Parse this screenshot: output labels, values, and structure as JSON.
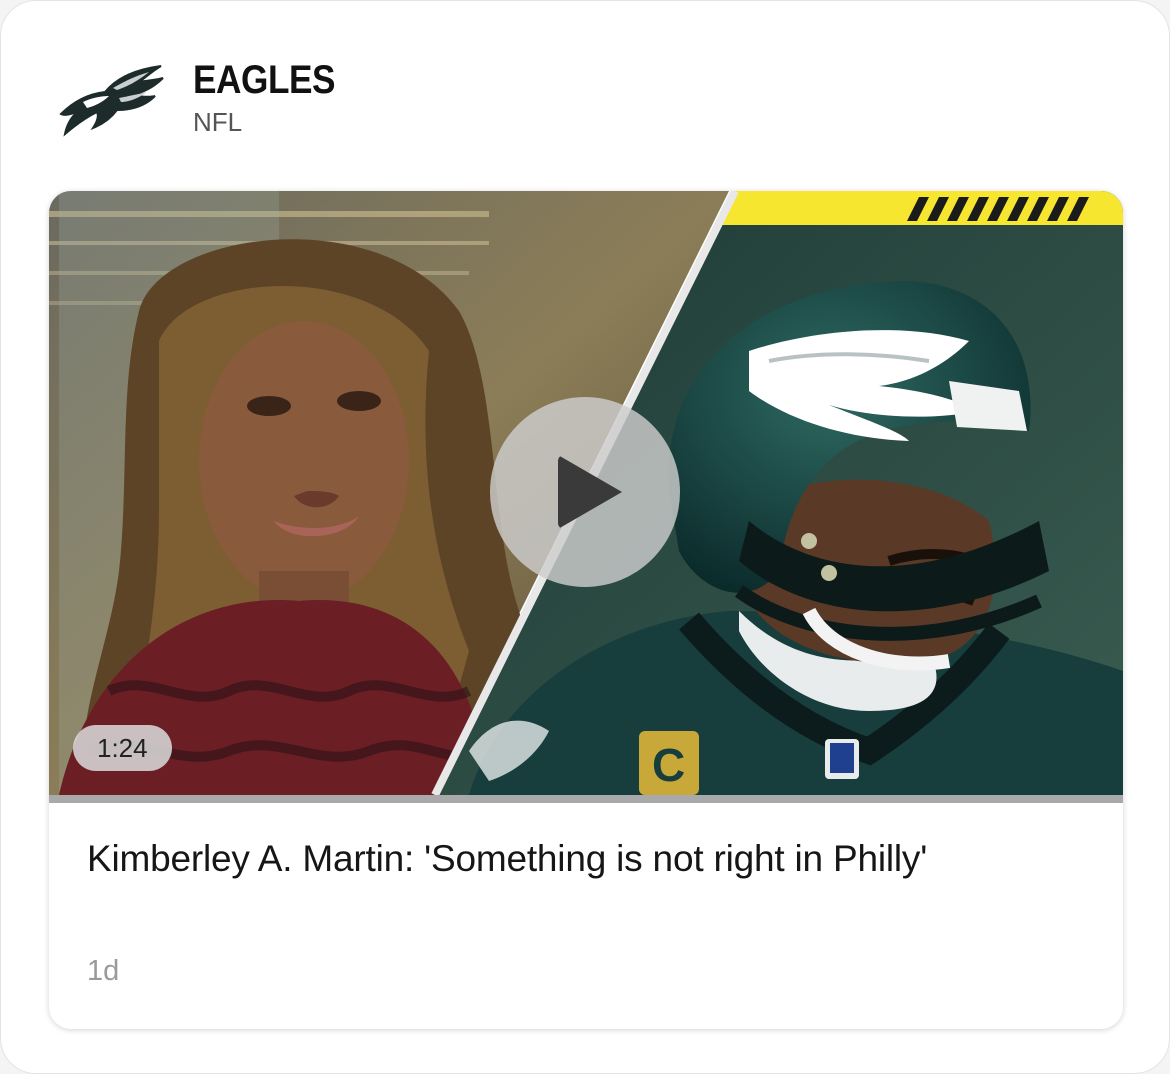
{
  "team": {
    "name": "EAGLES",
    "league": "NFL",
    "logo_icon": "eagles-logo-icon"
  },
  "video_card": {
    "duration": "1:24",
    "headline": "Kimberley A. Martin: 'Something is not right in Philly'",
    "time_ago": "1d",
    "play_icon": "play-icon",
    "thumbnail": "thumbnail-image",
    "progress_fraction": 0,
    "colors": {
      "accent_yellow": "#f6e62f",
      "eagles_green": "#0f3a3a"
    }
  }
}
